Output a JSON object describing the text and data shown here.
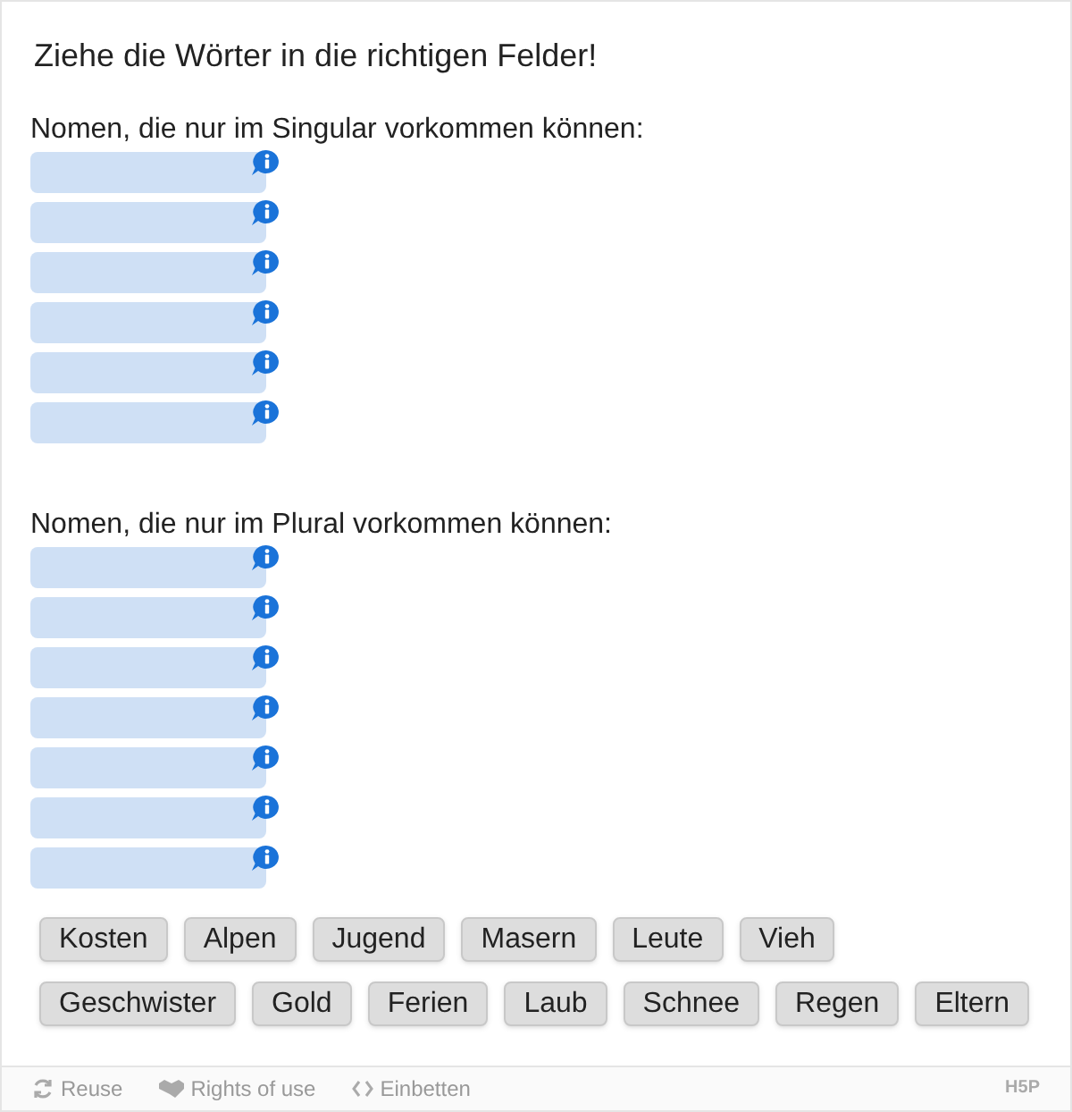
{
  "title": "Ziehe die Wörter in die richtigen Felder!",
  "sections": [
    {
      "heading": "Nomen, die nur im Singular vorkommen können:",
      "zones": [
        {
          "kind": "drop"
        },
        {
          "kind": "drop"
        },
        {
          "kind": "drop"
        },
        {
          "kind": "drop"
        },
        {
          "kind": "drop"
        },
        {
          "kind": "drop"
        }
      ]
    },
    {
      "heading": "Nomen, die nur im Plural vorkommen können:",
      "zones": [
        {
          "kind": "drop"
        },
        {
          "kind": "drop"
        },
        {
          "kind": "drop"
        },
        {
          "kind": "drop"
        },
        {
          "kind": "drop"
        },
        {
          "kind": "drop"
        },
        {
          "kind": "drop"
        }
      ]
    }
  ],
  "words": [
    [
      "Kosten",
      "Alpen",
      "Jugend",
      "Masern",
      "Leute",
      "Vieh"
    ],
    [
      "Geschwister",
      "Gold",
      "Ferien",
      "Laub",
      "Schnee",
      "Regen",
      "Eltern"
    ]
  ],
  "footer": {
    "links": [
      {
        "kind": "reuse",
        "label": "Reuse"
      },
      {
        "kind": "rights",
        "label": "Rights of use"
      },
      {
        "kind": "embed",
        "label": "Einbetten"
      }
    ],
    "logo": "H5P"
  }
}
